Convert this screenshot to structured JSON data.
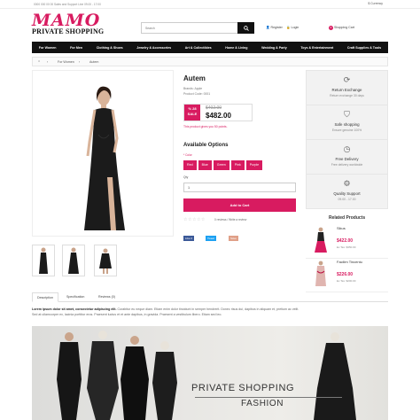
{
  "topbar": {
    "left_text": "0000 000 00 00   Sales and Support Line 09.00 - 17:00",
    "currency": "$ Currency"
  },
  "logo": {
    "brand": "MAMO",
    "tagline": "PRIVATE SHOPPING"
  },
  "search": {
    "placeholder": "Search"
  },
  "account": {
    "register": "Register",
    "login": "Login"
  },
  "cart": {
    "label": "Shopping Cart",
    "count": "0"
  },
  "nav": {
    "items": [
      "For Women",
      "For Men",
      "Clothing & Shoes",
      "Jewelry & Accessories",
      "Art & Collectibles",
      "Home & Living",
      "Wedding & Party",
      "Toys & Entertainment",
      "Craft Supplies & Tools"
    ]
  },
  "breadcrumb": {
    "level1": "For Women",
    "level2": "Autem"
  },
  "product": {
    "title": "Autem",
    "brand": "Brands: Apple",
    "code": "Product Code: 0001",
    "discount_pct": "% 28",
    "discount_word": "SALE",
    "old_price": "$402.00",
    "new_price": "$482.00",
    "points_note": "This product gives you 50 points.",
    "options_title": "Available Options",
    "color_label": "* Color",
    "colors": [
      "Red",
      "Blue",
      "Green",
      "Pink",
      "Purple"
    ],
    "qty_label": "Qty",
    "qty_value": "1",
    "add_to_cart": "Add to Cart",
    "stars": "☆☆☆☆☆",
    "reviews_text": "0 reviews / Write a review",
    "share": {
      "like": "Like 0",
      "tweet": "Tweet",
      "pin": "Save"
    }
  },
  "features": [
    {
      "icon": "refresh-icon",
      "glyph": "⟳",
      "title": "Return Exchange",
      "sub": "Return exchange 30 days"
    },
    {
      "icon": "shield-icon",
      "glyph": "⛉",
      "title": "Safe shopping",
      "sub": "Ensure genuine 100%"
    },
    {
      "icon": "clock-icon",
      "glyph": "◷",
      "title": "Free Delivery",
      "sub": "Free delivery worldwide"
    },
    {
      "icon": "gear-icon",
      "glyph": "⚙",
      "title": "Quality Support",
      "sub": "09.00 - 17.00"
    }
  ],
  "related": {
    "title": "Related Products",
    "items": [
      {
        "name": "Sikus",
        "price": "$422.00",
        "tax": "Ex Tax: $350.00"
      },
      {
        "name": "Facilim Tincentu",
        "price": "$226.00",
        "tax": "Ex Tax: $200.00"
      }
    ]
  },
  "tabs": {
    "description": "Description",
    "specification": "Specification",
    "reviews": "Reviews (0)"
  },
  "description": {
    "lead": "Lorem ipsum dolor sit amet, consectetur adipiscing elit.",
    "line1": "Curabitur eu neque diam. Etiam enim dolor tincidunt in semper hendrerit. Donec risus dui, dapibus in aliquam et, pretium ac velit.",
    "line2": "Sed at ullamcorper ex, lacinia porttitor eros. Praesent luctus et et ante dapibus, in gravida. Praesent a vestibulum libero. Etiam sed leo."
  },
  "banner": {
    "line1": "PRIVATE SHOPPING",
    "line2": "FASHION"
  },
  "colors": {
    "brand": "#d81b60",
    "nav": "#111111"
  }
}
